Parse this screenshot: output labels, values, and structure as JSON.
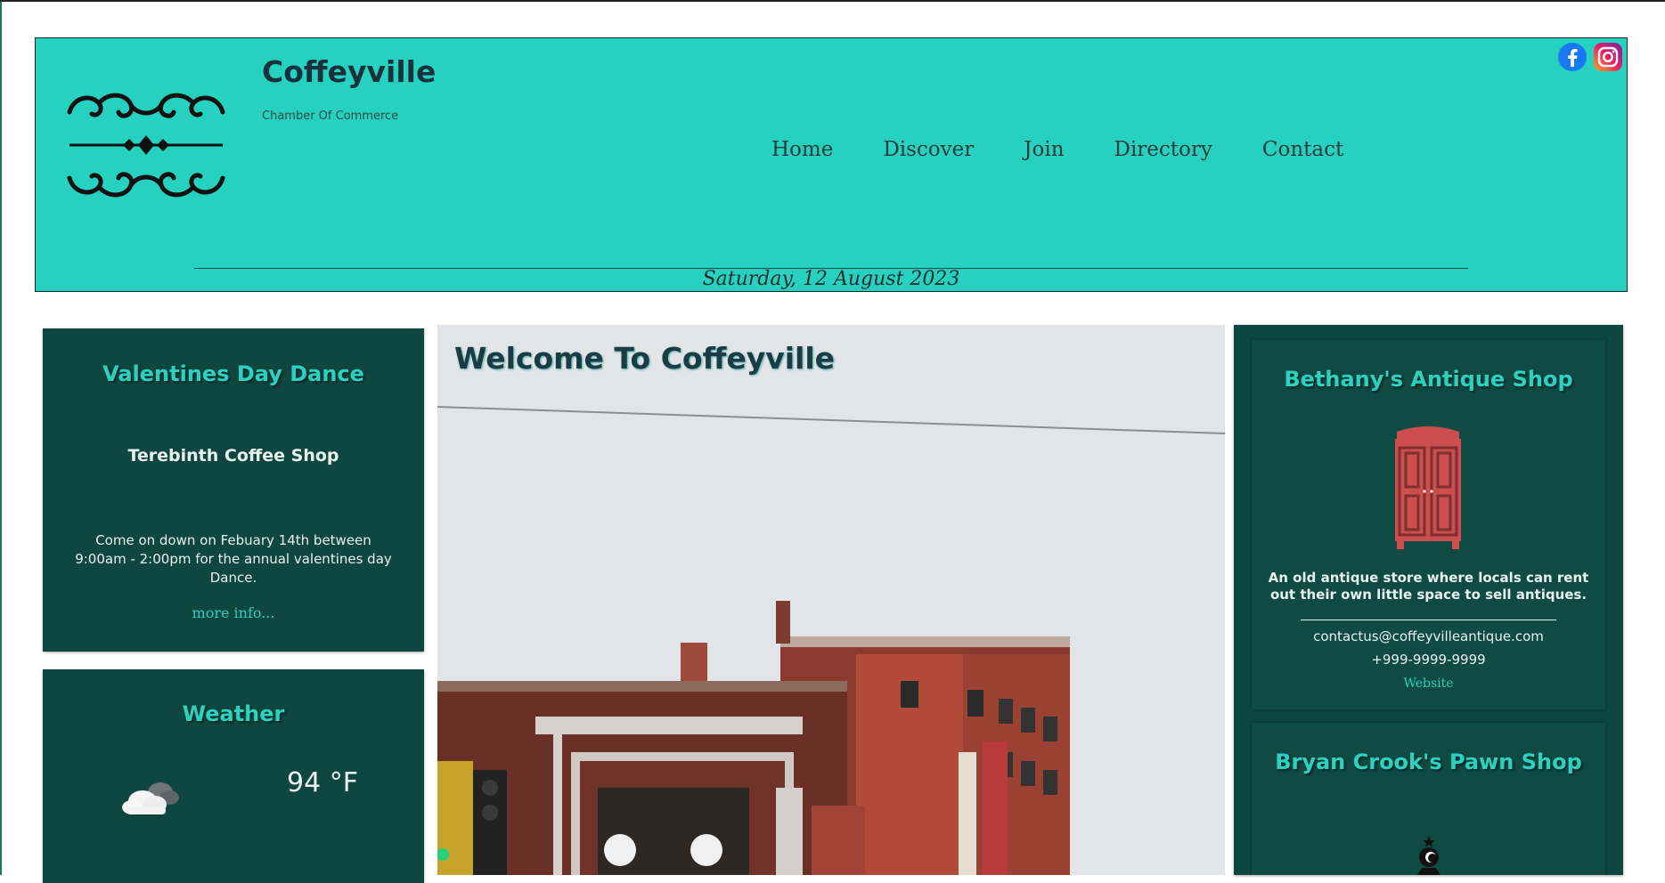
{
  "header": {
    "title": "Coffeyville",
    "subtitle": "Chamber Of Commerce",
    "date": "Saturday, 12 August 2023",
    "nav": [
      "Home",
      "Discover",
      "Join",
      "Directory",
      "Contact"
    ],
    "social": [
      "facebook-icon",
      "instagram-icon"
    ]
  },
  "event": {
    "title": "Valentines Day Dance",
    "venue": "Terebinth Coffee Shop",
    "description": "Come on down on Febuary 14th between 9:00am - 2:00pm for the annual valentines day Dance.",
    "link": "more info..."
  },
  "weather": {
    "title": "Weather",
    "temp": "94 °F",
    "icon": "partly-cloudy-icon"
  },
  "main": {
    "title": "Welcome To Coffeyville"
  },
  "directory": [
    {
      "name": "Bethany's Antique Shop",
      "description": "An old antique store where locals can rent out their own little space to sell antiques.",
      "email": "contactus@coffeyvilleantique.com",
      "phone": "+999-9999-9999",
      "website": "Website",
      "icon": "wardrobe-icon"
    },
    {
      "name": "Bryan Crook's Pawn Shop",
      "icon": "pawn-icon"
    }
  ],
  "colors": {
    "accent": "#27d1bf",
    "card": "#0f463f",
    "title_text": "#17323c"
  }
}
